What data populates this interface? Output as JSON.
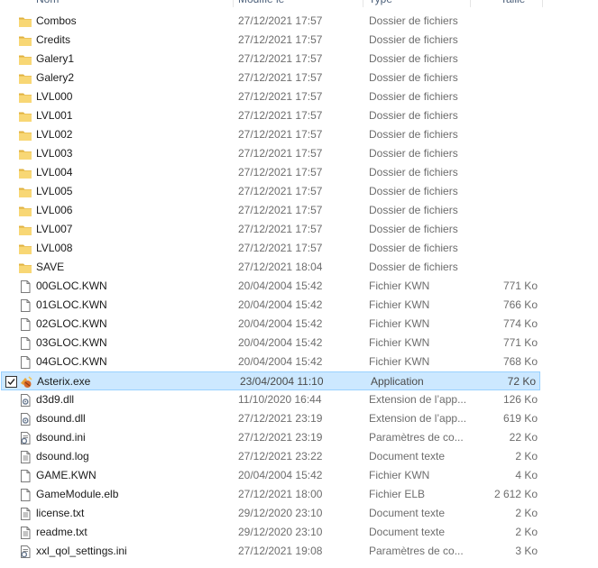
{
  "header": {
    "columns": [
      "Nom",
      "Modifié le",
      "Type",
      "Taille"
    ]
  },
  "files": [
    {
      "name": "Combos",
      "date": "27/12/2021 17:57",
      "type": "Dossier de fichiers",
      "size": "",
      "icon": "folder-icon"
    },
    {
      "name": "Credits",
      "date": "27/12/2021 17:57",
      "type": "Dossier de fichiers",
      "size": "",
      "icon": "folder-icon"
    },
    {
      "name": "Galery1",
      "date": "27/12/2021 17:57",
      "type": "Dossier de fichiers",
      "size": "",
      "icon": "folder-icon"
    },
    {
      "name": "Galery2",
      "date": "27/12/2021 17:57",
      "type": "Dossier de fichiers",
      "size": "",
      "icon": "folder-icon"
    },
    {
      "name": "LVL000",
      "date": "27/12/2021 17:57",
      "type": "Dossier de fichiers",
      "size": "",
      "icon": "folder-icon"
    },
    {
      "name": "LVL001",
      "date": "27/12/2021 17:57",
      "type": "Dossier de fichiers",
      "size": "",
      "icon": "folder-icon"
    },
    {
      "name": "LVL002",
      "date": "27/12/2021 17:57",
      "type": "Dossier de fichiers",
      "size": "",
      "icon": "folder-icon"
    },
    {
      "name": "LVL003",
      "date": "27/12/2021 17:57",
      "type": "Dossier de fichiers",
      "size": "",
      "icon": "folder-icon"
    },
    {
      "name": "LVL004",
      "date": "27/12/2021 17:57",
      "type": "Dossier de fichiers",
      "size": "",
      "icon": "folder-icon"
    },
    {
      "name": "LVL005",
      "date": "27/12/2021 17:57",
      "type": "Dossier de fichiers",
      "size": "",
      "icon": "folder-icon"
    },
    {
      "name": "LVL006",
      "date": "27/12/2021 17:57",
      "type": "Dossier de fichiers",
      "size": "",
      "icon": "folder-icon"
    },
    {
      "name": "LVL007",
      "date": "27/12/2021 17:57",
      "type": "Dossier de fichiers",
      "size": "",
      "icon": "folder-icon"
    },
    {
      "name": "LVL008",
      "date": "27/12/2021 17:57",
      "type": "Dossier de fichiers",
      "size": "",
      "icon": "folder-icon"
    },
    {
      "name": "SAVE",
      "date": "27/12/2021 18:04",
      "type": "Dossier de fichiers",
      "size": "",
      "icon": "folder-icon"
    },
    {
      "name": "00GLOC.KWN",
      "date": "20/04/2004 15:42",
      "type": "Fichier KWN",
      "size": "771 Ko",
      "icon": "file-icon"
    },
    {
      "name": "01GLOC.KWN",
      "date": "20/04/2004 15:42",
      "type": "Fichier KWN",
      "size": "766 Ko",
      "icon": "file-icon"
    },
    {
      "name": "02GLOC.KWN",
      "date": "20/04/2004 15:42",
      "type": "Fichier KWN",
      "size": "774 Ko",
      "icon": "file-icon"
    },
    {
      "name": "03GLOC.KWN",
      "date": "20/04/2004 15:42",
      "type": "Fichier KWN",
      "size": "771 Ko",
      "icon": "file-icon"
    },
    {
      "name": "04GLOC.KWN",
      "date": "20/04/2004 15:42",
      "type": "Fichier KWN",
      "size": "768 Ko",
      "icon": "file-icon"
    },
    {
      "name": "Asterix.exe",
      "date": "23/04/2004 11:10",
      "type": "Application",
      "size": "72 Ko",
      "icon": "asterix-app-icon",
      "selected": true
    },
    {
      "name": "d3d9.dll",
      "date": "11/10/2020 16:44",
      "type": "Extension de l’app...",
      "size": "126 Ko",
      "icon": "dll-icon"
    },
    {
      "name": "dsound.dll",
      "date": "27/12/2021 23:19",
      "type": "Extension de l’app...",
      "size": "619 Ko",
      "icon": "dll-icon"
    },
    {
      "name": "dsound.ini",
      "date": "27/12/2021 23:19",
      "type": "Paramètres de co...",
      "size": "22 Ko",
      "icon": "ini-icon"
    },
    {
      "name": "dsound.log",
      "date": "27/12/2021 23:22",
      "type": "Document texte",
      "size": "2 Ko",
      "icon": "text-file-icon"
    },
    {
      "name": "GAME.KWN",
      "date": "20/04/2004 15:42",
      "type": "Fichier KWN",
      "size": "4 Ko",
      "icon": "file-icon"
    },
    {
      "name": "GameModule.elb",
      "date": "27/12/2021 18:00",
      "type": "Fichier ELB",
      "size": "2 612 Ko",
      "icon": "file-icon"
    },
    {
      "name": "license.txt",
      "date": "29/12/2020 23:10",
      "type": "Document texte",
      "size": "2 Ko",
      "icon": "text-file-icon"
    },
    {
      "name": "readme.txt",
      "date": "29/12/2020 23:10",
      "type": "Document texte",
      "size": "2 Ko",
      "icon": "text-file-icon"
    },
    {
      "name": "xxl_qol_settings.ini",
      "date": "27/12/2021 19:08",
      "type": "Paramètres de co...",
      "size": "3 Ko",
      "icon": "ini-icon"
    }
  ],
  "colors": {
    "folder": "#f8d775",
    "folder_dark": "#e0b240",
    "selection_bg": "#cce8ff",
    "selection_border": "#99d1ff",
    "secondary_text": "#6d6d6d"
  }
}
